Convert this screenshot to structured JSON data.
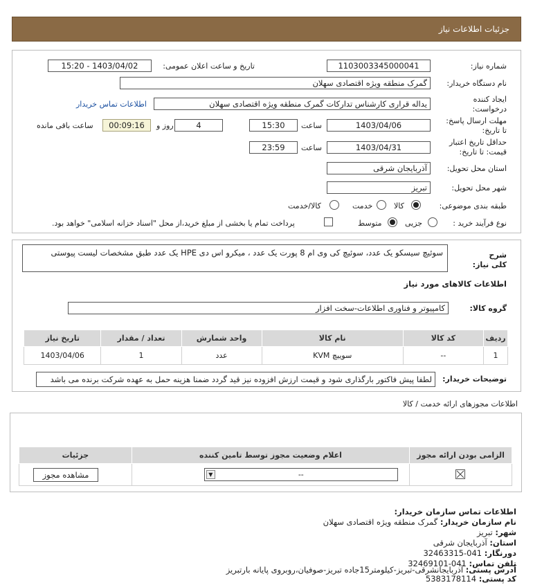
{
  "header": {
    "title": "جزئیات اطلاعات نیاز"
  },
  "form": {
    "need_number_label": "شماره نیاز:",
    "need_number": "1103003345000041",
    "announce_label": "تاریخ و ساعت اعلان عمومی:",
    "announce_value": "1403/04/02 - 15:20",
    "buyer_org_label": "نام دستگاه خریدار:",
    "buyer_org": "گمرک منطقه ویژه اقتصادی سهلان",
    "creator_label": "ایجاد کننده درخواست:",
    "creator": "یداله قراری کارشناس تدارکات گمرک منطقه ویژه اقتصادی سهلان",
    "contact_link": "اطلاعات تماس خریدار",
    "deadline_label": "مهلت ارسال پاسخ: تا تاریخ:",
    "deadline_date": "1403/04/06",
    "time_label": "ساعت",
    "deadline_time": "15:30",
    "days_value": "4",
    "days_label": "روز و",
    "timer": "00:09:16",
    "remaining_label": "ساعت باقی مانده",
    "validity_label": "حداقل تاریخ اعتبار قیمت: تا تاریخ:",
    "validity_date": "1403/04/31",
    "validity_time": "23:59",
    "province_label": "استان محل تحویل:",
    "province": "آذربایجان شرقی",
    "city_label": "شهر محل تحویل:",
    "city": "تبریز",
    "category_label": "طبقه بندی موضوعی:",
    "category_options": [
      "کالا",
      "خدمت",
      "کالا/خدمت"
    ],
    "process_label": "نوع فرآیند خرید :",
    "process_options": [
      "جزیی",
      "متوسط"
    ],
    "payment_note": "پرداخت تمام یا بخشی از مبلغ خرید،از محل \"اسناد خزانه اسلامی\" خواهد بود."
  },
  "description": {
    "label": "شرح کلی نیاز:",
    "text": "سوئیچ سیسکو یک عدد، سوئیچ کی وی ام 8 پورت یک عدد ، میکرو اس دی HPE یک عدد طبق مشخصات لیست پیوستی"
  },
  "goods": {
    "section_title": "اطلاعات کالاهای مورد نیاز",
    "group_label": "گروه کالا:",
    "group_value": "کامپیوتر و فناوری اطلاعات-سخت افزار",
    "columns": [
      "ردیف",
      "کد کالا",
      "نام کالا",
      "واحد شمارش",
      "تعداد / مقدار",
      "تاریخ نیاز"
    ],
    "rows": [
      [
        "1",
        "--",
        "سوییچ KVM",
        "عدد",
        "1",
        "1403/04/06"
      ]
    ]
  },
  "buyer_notes": {
    "label": "توضیحات خریدار:",
    "text": "لطفا پیش فاکتور بارگذاری شود و قیمت ارزش افزوده نیز قید گردد ضمنا هزینه حمل به عهده شرکت برنده می باشد"
  },
  "permits": {
    "section_title": "اطلاعات مجوزهای ارائه خدمت / کالا",
    "columns": [
      "الزامی بودن ارائه مجوز",
      "اعلام وضعیت مجوز توسط تامین کننده",
      "جزئیات"
    ],
    "select_value": "--",
    "view_button": "مشاهده مجوز"
  },
  "contact": {
    "title": "اطلاعات تماس سازمان خریدار:",
    "org_label": "نام سازمان خریدار:",
    "org_value": "گمرک منطقه ویژه اقتصادی سهلان",
    "city_label": "شهر:",
    "city_value": "تبریز",
    "province_label": "استان:",
    "province_value": "آذربایجان شرقی",
    "fax_label": "دورنگار:",
    "fax_value": "041-32463315",
    "phone_label": "تلفن تماس:",
    "phone_value": "041-32469101",
    "address_label": "آدرس پستی:",
    "address_value": "آذربایجانشرقی-تبریز-کیلومتر15جاده تبریز-صوفیان،روبروی پایانه بارتبریز",
    "postal_label": "کد پستی:",
    "postal_value": "5383178114"
  }
}
